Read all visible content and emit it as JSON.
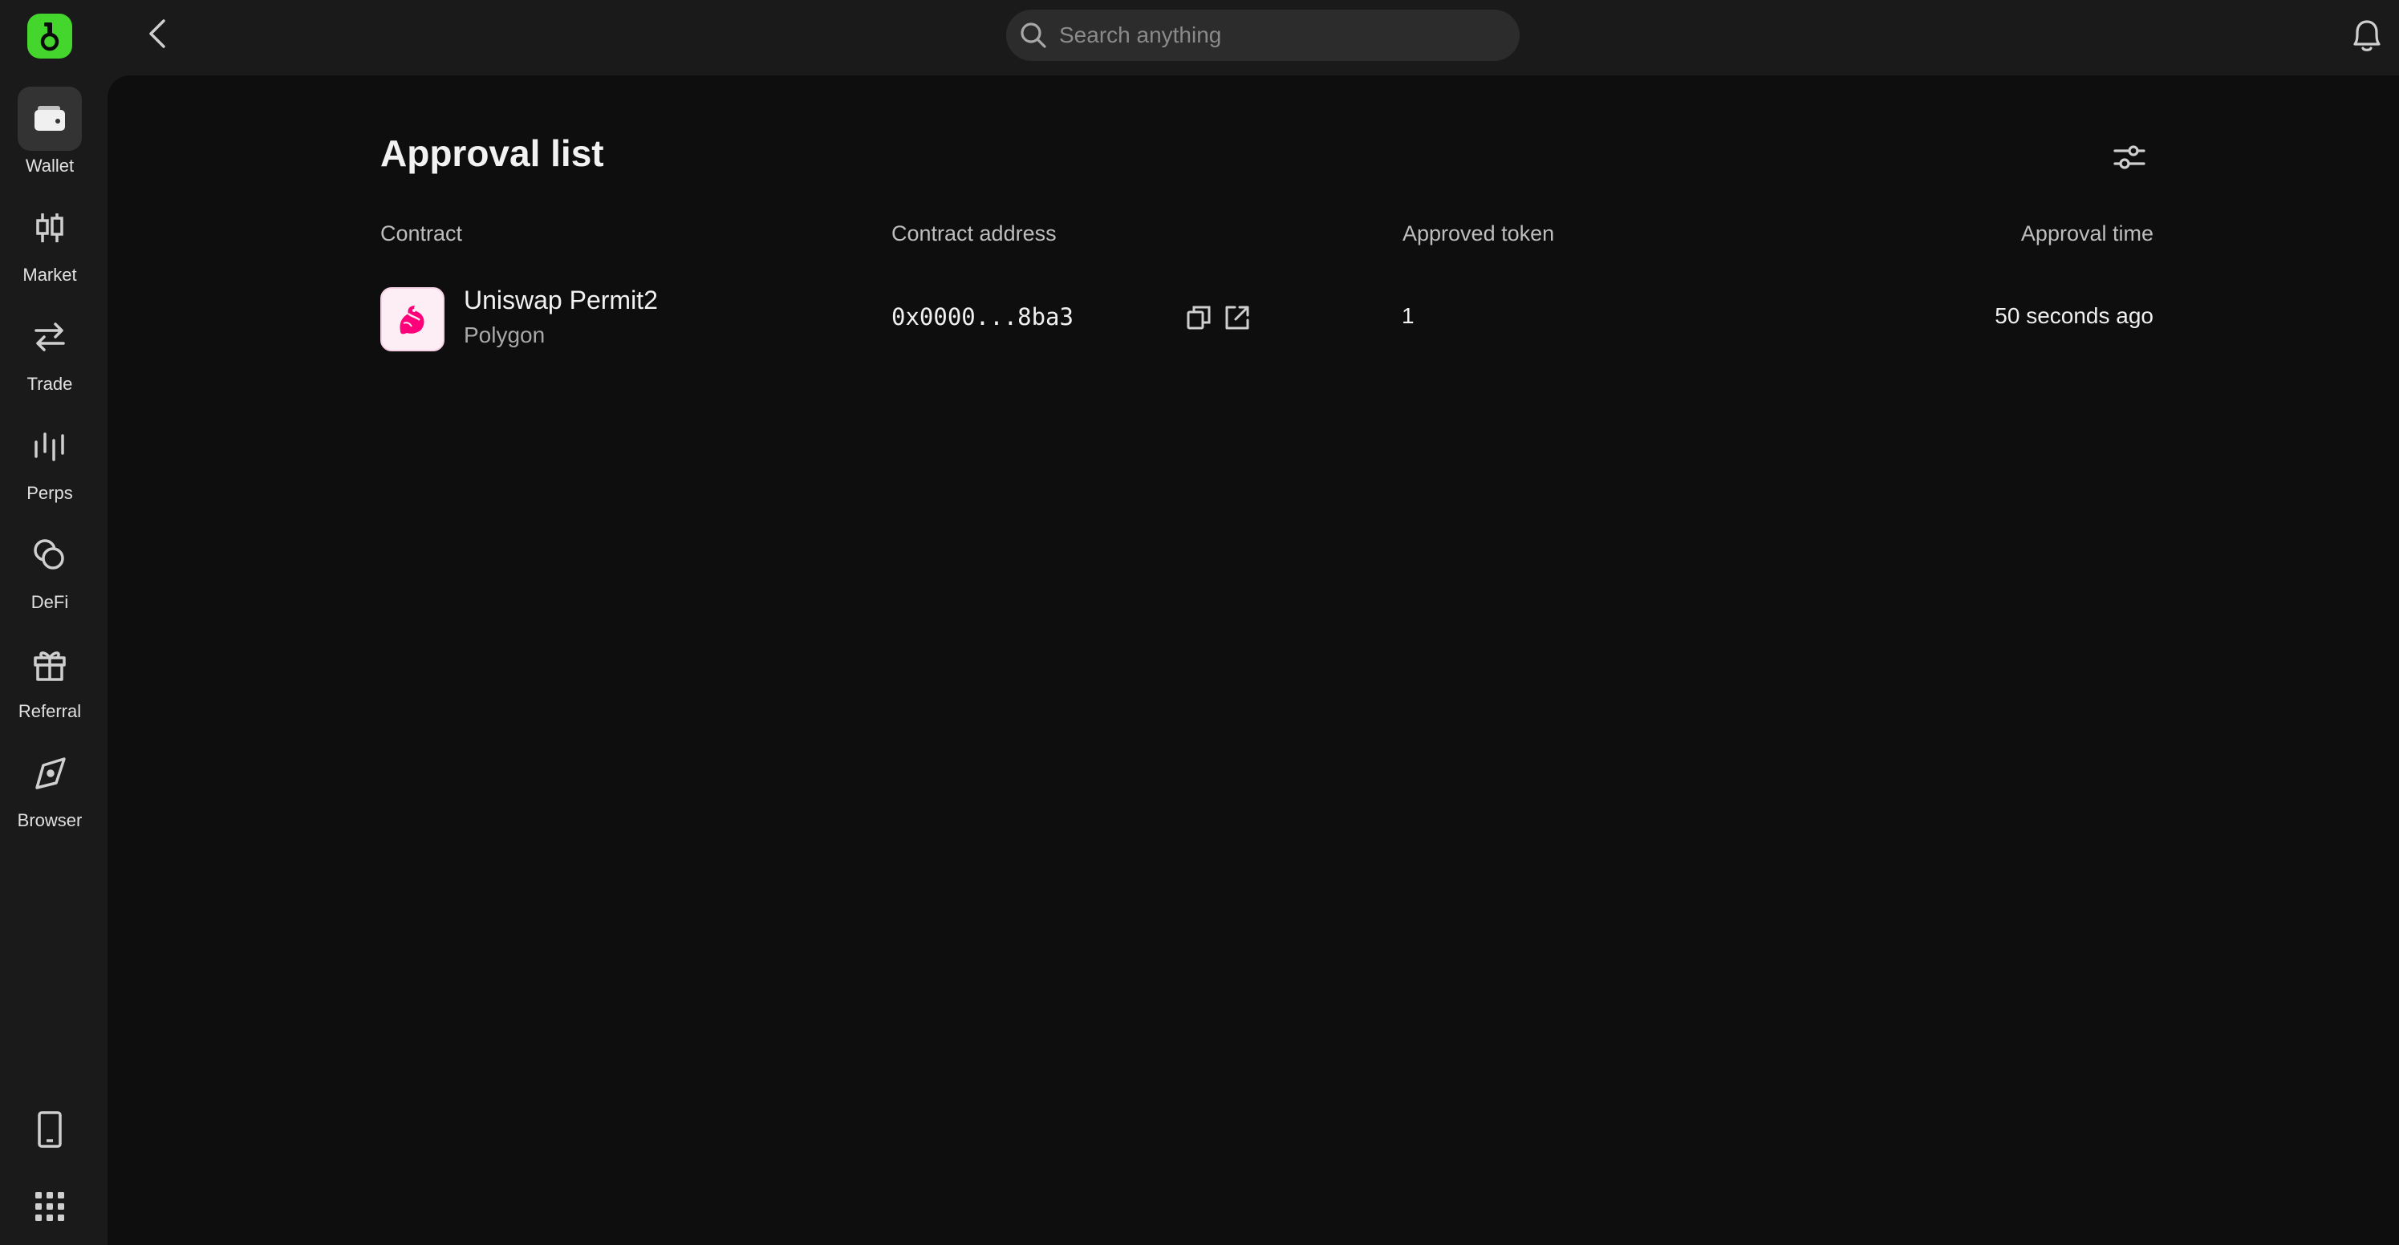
{
  "sidebar": {
    "items": [
      {
        "label": "Wallet",
        "icon": "wallet-icon",
        "active": true
      },
      {
        "label": "Market",
        "icon": "candlestick-icon"
      },
      {
        "label": "Trade",
        "icon": "swap-arrows-icon"
      },
      {
        "label": "Perps",
        "icon": "bars-icon"
      },
      {
        "label": "DeFi",
        "icon": "circles-icon"
      },
      {
        "label": "Referral",
        "icon": "gift-icon"
      },
      {
        "label": "Browser",
        "icon": "compass-icon"
      }
    ],
    "bottom": [
      {
        "icon": "mobile-device-icon"
      },
      {
        "icon": "apps-grid-icon"
      }
    ]
  },
  "topbar": {
    "search_placeholder": "Search anything"
  },
  "page": {
    "title": "Approval list",
    "columns": {
      "contract": "Contract",
      "contract_address": "Contract address",
      "approved_token": "Approved token",
      "approval_time": "Approval time"
    },
    "rows": [
      {
        "contract": "Uniswap Permit2",
        "chain": "Polygon",
        "address": "0x0000...8ba3",
        "approved_token": "1",
        "approval_time": "50 seconds ago"
      }
    ]
  },
  "colors": {
    "brand": "#44d62c",
    "background": "#1a1a1a",
    "panel": "#0e0e0e",
    "uniswap_pink": "#ff007a"
  }
}
